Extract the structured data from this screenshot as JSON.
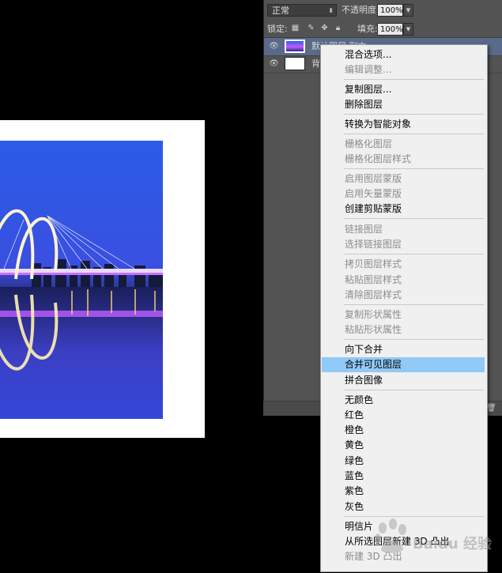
{
  "options_bar": {
    "blend_mode": "正常",
    "opacity_label": "不透明度:",
    "opacity_value": "100%",
    "lock_label": "锁定:",
    "fill_label": "填充:",
    "fill_value": "100%"
  },
  "layers": [
    {
      "name": "默认图层  副本",
      "visible": true,
      "selected": true
    },
    {
      "name": "背景",
      "visible": true,
      "selected": false
    }
  ],
  "context_menu": {
    "items": [
      {
        "label": "混合选项...",
        "enabled": true
      },
      {
        "label": "编辑调整...",
        "enabled": false
      },
      {
        "label": "复制图层...",
        "enabled": true
      },
      {
        "label": "删除图层",
        "enabled": true
      },
      {
        "label": "转换为智能对象",
        "enabled": true
      },
      {
        "label": "栅格化图层",
        "enabled": false
      },
      {
        "label": "栅格化图层样式",
        "enabled": false
      },
      {
        "label": "启用图层蒙版",
        "enabled": false
      },
      {
        "label": "启用矢量蒙版",
        "enabled": false
      },
      {
        "label": "创建剪贴蒙版",
        "enabled": true
      },
      {
        "label": "链接图层",
        "enabled": false
      },
      {
        "label": "选择链接图层",
        "enabled": false
      },
      {
        "label": "拷贝图层样式",
        "enabled": false
      },
      {
        "label": "粘贴图层样式",
        "enabled": false
      },
      {
        "label": "清除图层样式",
        "enabled": false
      },
      {
        "label": "复制形状属性",
        "enabled": false
      },
      {
        "label": "粘贴形状属性",
        "enabled": false
      },
      {
        "label": "向下合并",
        "enabled": true
      },
      {
        "label": "合并可见图层",
        "enabled": true,
        "highlighted": true
      },
      {
        "label": "拼合图像",
        "enabled": true
      },
      {
        "label": "无颜色",
        "enabled": true
      },
      {
        "label": "红色",
        "enabled": true
      },
      {
        "label": "橙色",
        "enabled": true
      },
      {
        "label": "黄色",
        "enabled": true
      },
      {
        "label": "绿色",
        "enabled": true
      },
      {
        "label": "蓝色",
        "enabled": true
      },
      {
        "label": "紫色",
        "enabled": true
      },
      {
        "label": "灰色",
        "enabled": true
      },
      {
        "label": "明信片",
        "enabled": true
      },
      {
        "label": "从所选图层新建 3D 凸出",
        "enabled": true
      },
      {
        "label": "新建 3D 凸出",
        "enabled": false
      }
    ]
  },
  "watermark": {
    "text": "Baidu 经验"
  },
  "colors": {
    "panel_bg": "#535353",
    "menu_bg": "#f0f0f0",
    "menu_highlight": "#91c9f7",
    "canvas_bg": "#000000"
  }
}
